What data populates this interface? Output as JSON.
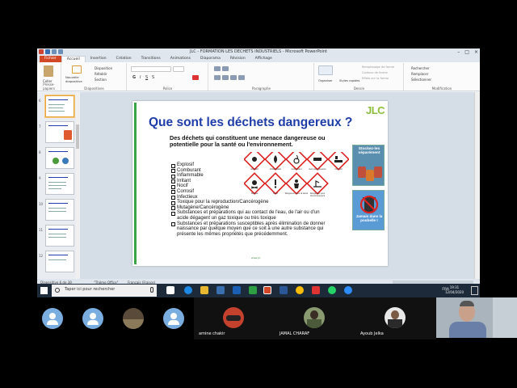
{
  "window": {
    "title": "JLC - FORMATION LES DECHETS INDUSTRIELS  -  Microsoft PowerPoint",
    "controls": [
      "–",
      "□",
      "×"
    ]
  },
  "ribbon": {
    "tabs": [
      "Fichier",
      "Accueil",
      "Insertion",
      "Création",
      "Transitions",
      "Animations",
      "Diaporama",
      "Révision",
      "Affichage"
    ],
    "groups": {
      "clipboard": {
        "label": "Presse-papiers",
        "paste": "Coller"
      },
      "slides": {
        "label": "Diapositives",
        "new_slide": "Nouvelle diapositive",
        "layout": "Disposition",
        "reset": "Rétablir",
        "section": "Section"
      },
      "font": {
        "label": "Police"
      },
      "paragraph": {
        "label": "Paragraphe"
      },
      "drawing": {
        "label": "Dessin",
        "arrange": "Organiser",
        "quick_styles": "Styles rapides",
        "fill": "Remplissage de forme",
        "outline": "Contour de forme",
        "effects": "Effets sur la forme"
      },
      "editing": {
        "label": "Modification",
        "find": "Rechercher",
        "replace": "Remplacer",
        "select": "Sélectionner"
      }
    }
  },
  "thumbnails": {
    "numbers": [
      "6",
      "7",
      "8",
      "9",
      "10",
      "11",
      "12"
    ]
  },
  "slide": {
    "title": "Que sont les déchets dangereux ?",
    "logo": "JLC",
    "intro": "Des déchets qui constituent une menace dangereuse ou potentielle pour la santé ou l'environnement.",
    "bullets": [
      "Explosif",
      "Comburant",
      "Inflammable",
      "Irritant",
      "Nocif",
      "Corrosif",
      "Infectieux",
      "Toxique pour la reproduction/Cancérogène",
      "Mutagène/Cancérogène",
      "Substances et préparations qui au contact de l'eau, de l'air ou d'un acide dégagent un gaz toxique ou très toxique",
      "Substances et préparations susceptibles après élimination de donner naissance par quelque moyen que ce soit à une autre substance qui présente les mêmes propriétés que précédemment."
    ],
    "pictogram_labels": [
      "Explosif",
      "Inflammable",
      "Comburant",
      "Gaz sous pression",
      "Corrosif",
      "Toxique",
      "Nocif",
      "Dangereux pour la santé",
      "Dangereux pour l'environnement"
    ],
    "poster1": "Stockez-les séparément",
    "poster2": "Jamais dans la poubelle !",
    "footer": "www.jlc"
  },
  "statusbar": {
    "slide_info": "Diapositive 6 de 39",
    "theme": "\"Thème Office\"",
    "language": "Français (France)"
  },
  "taskbar": {
    "search_placeholder": "Taper ici pour rechercher",
    "language": "FRA",
    "time": "19:31",
    "date": "12/04/2020"
  },
  "participants": [
    {
      "name": ""
    },
    {
      "name": ""
    },
    {
      "name": ""
    },
    {
      "name": ""
    },
    {
      "name": "amine chakir"
    },
    {
      "name": "JAMAL CHARAF"
    },
    {
      "name": "Ayoub Jelka"
    }
  ],
  "colors": {
    "title_blue": "#1f3da8",
    "slide_green": "#3aa548",
    "file_tab": "#d24726",
    "avatar_blue": "#7aaee0"
  }
}
